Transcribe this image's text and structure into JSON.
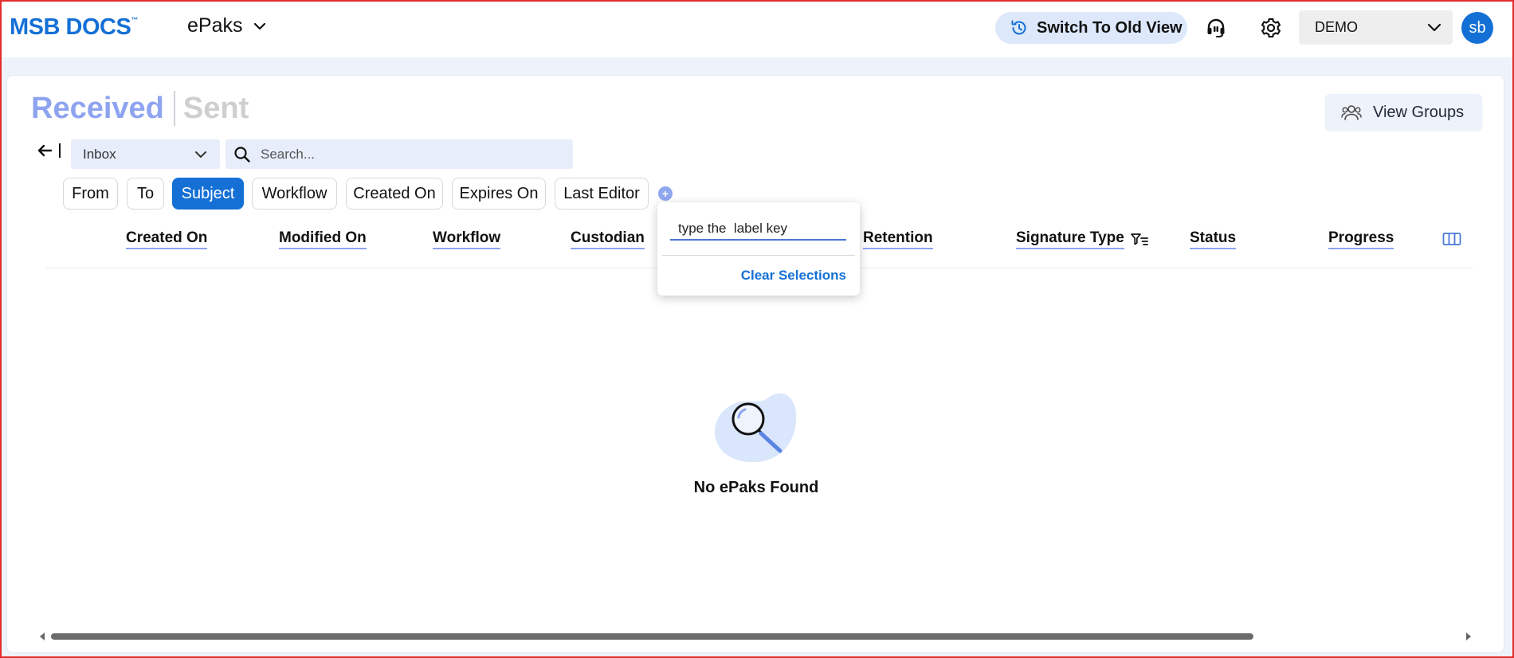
{
  "header": {
    "logo_text": "MSB DOCS",
    "logo_tm": "™",
    "app_name": "ePaks",
    "switch_view_label": "Switch To Old View",
    "org_selected": "DEMO",
    "avatar_initials": "sb",
    "brand_color": "#1570d6"
  },
  "tabs": {
    "received": "Received",
    "sent": "Sent"
  },
  "view_groups_label": "View Groups",
  "toolbar": {
    "folder_selected": "Inbox",
    "search_placeholder": "Search..."
  },
  "filter_chips": [
    {
      "label": "From",
      "active": false
    },
    {
      "label": "To",
      "active": false
    },
    {
      "label": "Subject",
      "active": true
    },
    {
      "label": "Workflow",
      "active": false
    },
    {
      "label": "Created On",
      "active": false
    },
    {
      "label": "Expires On",
      "active": false
    },
    {
      "label": "Last Editor",
      "active": false
    }
  ],
  "columns": [
    "Created On",
    "Modified On",
    "Workflow",
    "Custodian",
    "Retention",
    "Signature Type",
    "Status",
    "Progress"
  ],
  "label_popup": {
    "input_placeholder": "type the  label key",
    "clear_label": "Clear Selections"
  },
  "empty_state": {
    "message": "No ePaks Found"
  }
}
